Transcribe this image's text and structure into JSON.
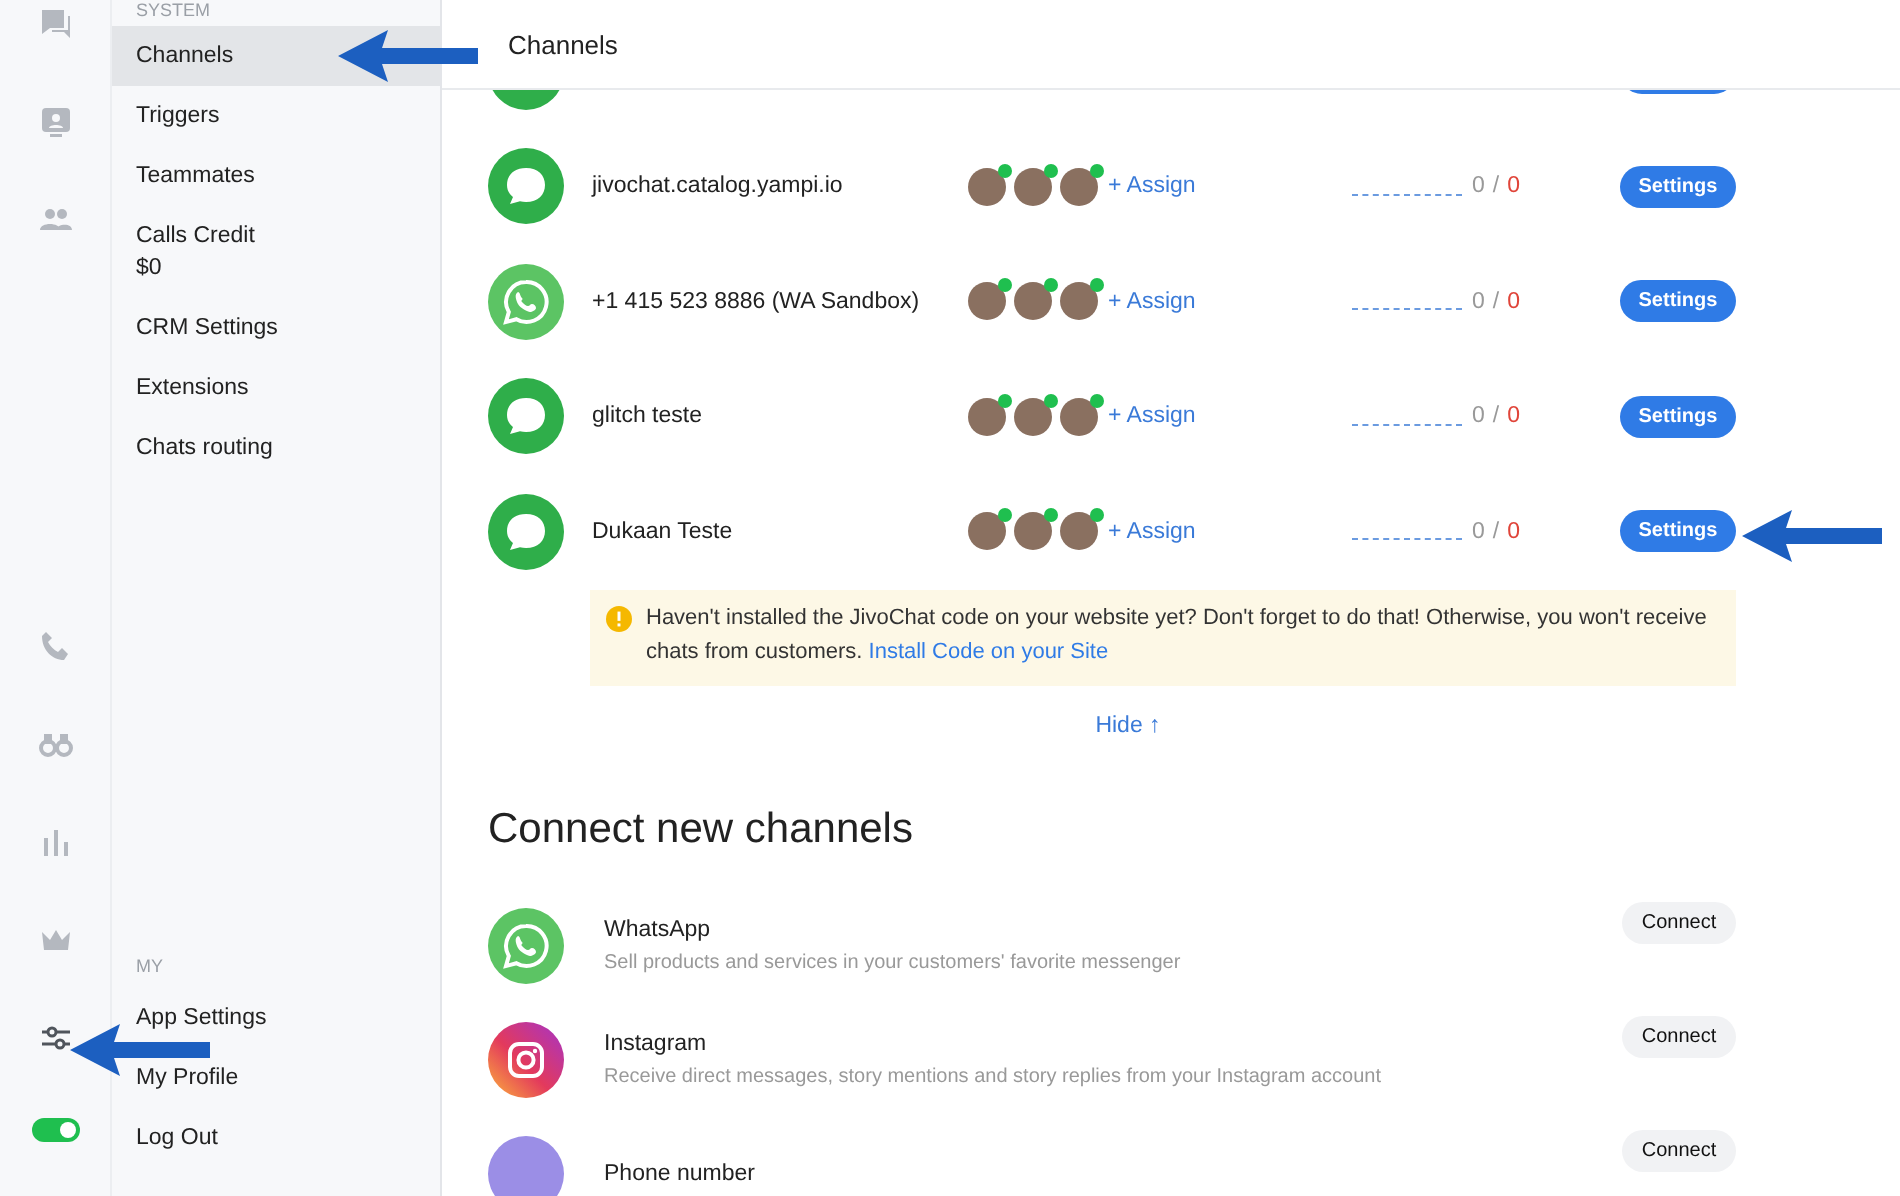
{
  "rail": [
    {
      "kind": "chats",
      "selected": false
    },
    {
      "kind": "contact",
      "selected": false
    },
    {
      "kind": "team",
      "selected": false
    },
    {
      "kind": "phone",
      "selected": false
    },
    {
      "kind": "binoculars",
      "selected": false
    },
    {
      "kind": "stats",
      "selected": false
    },
    {
      "kind": "crown",
      "selected": false
    },
    {
      "kind": "sliders",
      "selected": true
    }
  ],
  "status_toggle": {
    "on": true
  },
  "sidebar": {
    "system_heading": "SYSTEM",
    "system_items": [
      {
        "label": "Channels",
        "selected": true
      },
      {
        "label": "Triggers",
        "selected": false
      },
      {
        "label": "Teammates",
        "selected": false
      },
      {
        "label": "Calls Credit",
        "sub": "$0",
        "selected": false
      },
      {
        "label": "CRM Settings",
        "selected": false
      },
      {
        "label": "Extensions",
        "selected": false
      },
      {
        "label": "Chats routing",
        "selected": false
      }
    ],
    "my_heading": "MY",
    "my_items": [
      {
        "label": "App Settings",
        "selected": false
      },
      {
        "label": "My Profile",
        "selected": false
      },
      {
        "label": "Log Out",
        "selected": false
      }
    ]
  },
  "header": {
    "title": "Channels"
  },
  "partial_channel": {
    "kind": "chat"
  },
  "channels": [
    {
      "kind": "chat",
      "name": "jivochat.catalog.yampi.io",
      "agents": [
        {
          "online": true
        },
        {
          "online": true
        },
        {
          "online": true
        }
      ],
      "assign": "+ Assign",
      "used": "0",
      "separator": "/",
      "limit": "0",
      "button": "Settings"
    },
    {
      "kind": "whatsapp",
      "name": "+1 415 523 8886 (WA Sandbox)",
      "agents": [
        {
          "online": true
        },
        {
          "online": true
        },
        {
          "online": true
        }
      ],
      "assign": "+ Assign",
      "used": "0",
      "separator": "/",
      "limit": "0",
      "button": "Settings"
    },
    {
      "kind": "chat",
      "name": "glitch teste",
      "agents": [
        {
          "online": true
        },
        {
          "online": true
        },
        {
          "online": true
        }
      ],
      "assign": "+ Assign",
      "used": "0",
      "separator": "/",
      "limit": "0",
      "button": "Settings"
    },
    {
      "kind": "chat",
      "name": "Dukaan Teste",
      "agents": [
        {
          "online": true
        },
        {
          "online": true
        },
        {
          "online": true
        }
      ],
      "assign": "+ Assign",
      "used": "0",
      "separator": "/",
      "limit": "0",
      "button": "Settings"
    }
  ],
  "notice": {
    "text": "Haven't installed the JivoChat code on your website yet? Don't forget to do that! Otherwise, you won't receive chats from customers.",
    "link": "Install Code on your Site"
  },
  "hide_link": "Hide ↑",
  "connect": {
    "title": "Connect new channels",
    "items": [
      {
        "kind": "whatsapp",
        "name": "WhatsApp",
        "description": "Sell products and services in your customers' favorite messenger",
        "button": "Connect"
      },
      {
        "kind": "instagram",
        "name": "Instagram",
        "description": "Receive direct messages, story mentions and story replies from your Instagram account",
        "button": "Connect"
      },
      {
        "kind": "phone",
        "name": "Phone number",
        "button": "Connect"
      }
    ]
  },
  "annotations": [
    {
      "kind": "arrow"
    },
    {
      "kind": "arrow"
    },
    {
      "kind": "arrow"
    }
  ]
}
